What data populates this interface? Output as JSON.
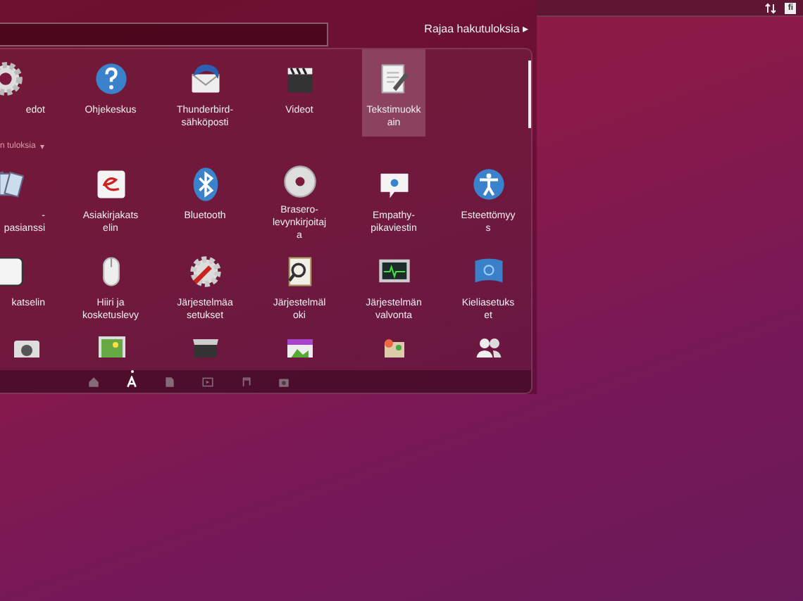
{
  "search": {
    "filter_label": "Rajaa hakutuloksia",
    "filter_arrow": "▸"
  },
  "top_panel": {
    "keyboard_layout": "fi"
  },
  "sections": [
    {
      "items": [
        {
          "label": "edot",
          "selected": false
        },
        {
          "label": "Ohjekeskus",
          "selected": false
        },
        {
          "label": "Thunderbird-sähköposti",
          "selected": false
        },
        {
          "label": "Videot",
          "selected": false
        },
        {
          "label": "Tekstimuokkain",
          "selected": true
        }
      ]
    },
    {
      "header": "n tuloksia",
      "header_arrow": "▾",
      "items": [
        {
          "label": "-pasianssi",
          "selected": false
        },
        {
          "label": "Asiakirjakatselin",
          "selected": false
        },
        {
          "label": "Bluetooth",
          "selected": false
        },
        {
          "label": "Brasero-levynkirjoitaja",
          "selected": false
        },
        {
          "label": "Empathy-pikaviestin",
          "selected": false
        },
        {
          "label": "Esteettömyys",
          "selected": false
        },
        {
          "label": "katselin",
          "selected": false
        },
        {
          "label": "Hiiri ja kosketuslevy",
          "selected": false
        },
        {
          "label": "Järjestelmäasetukset",
          "selected": false
        },
        {
          "label": "Järjestelmäloki",
          "selected": false
        },
        {
          "label": "Järjestelmän valvonta",
          "selected": false
        },
        {
          "label": "Kieliasetukset",
          "selected": false
        }
      ]
    }
  ],
  "lenses": [
    {
      "selected": false
    },
    {
      "selected": true
    },
    {
      "selected": false
    },
    {
      "selected": false
    },
    {
      "selected": false
    },
    {
      "selected": false
    }
  ]
}
